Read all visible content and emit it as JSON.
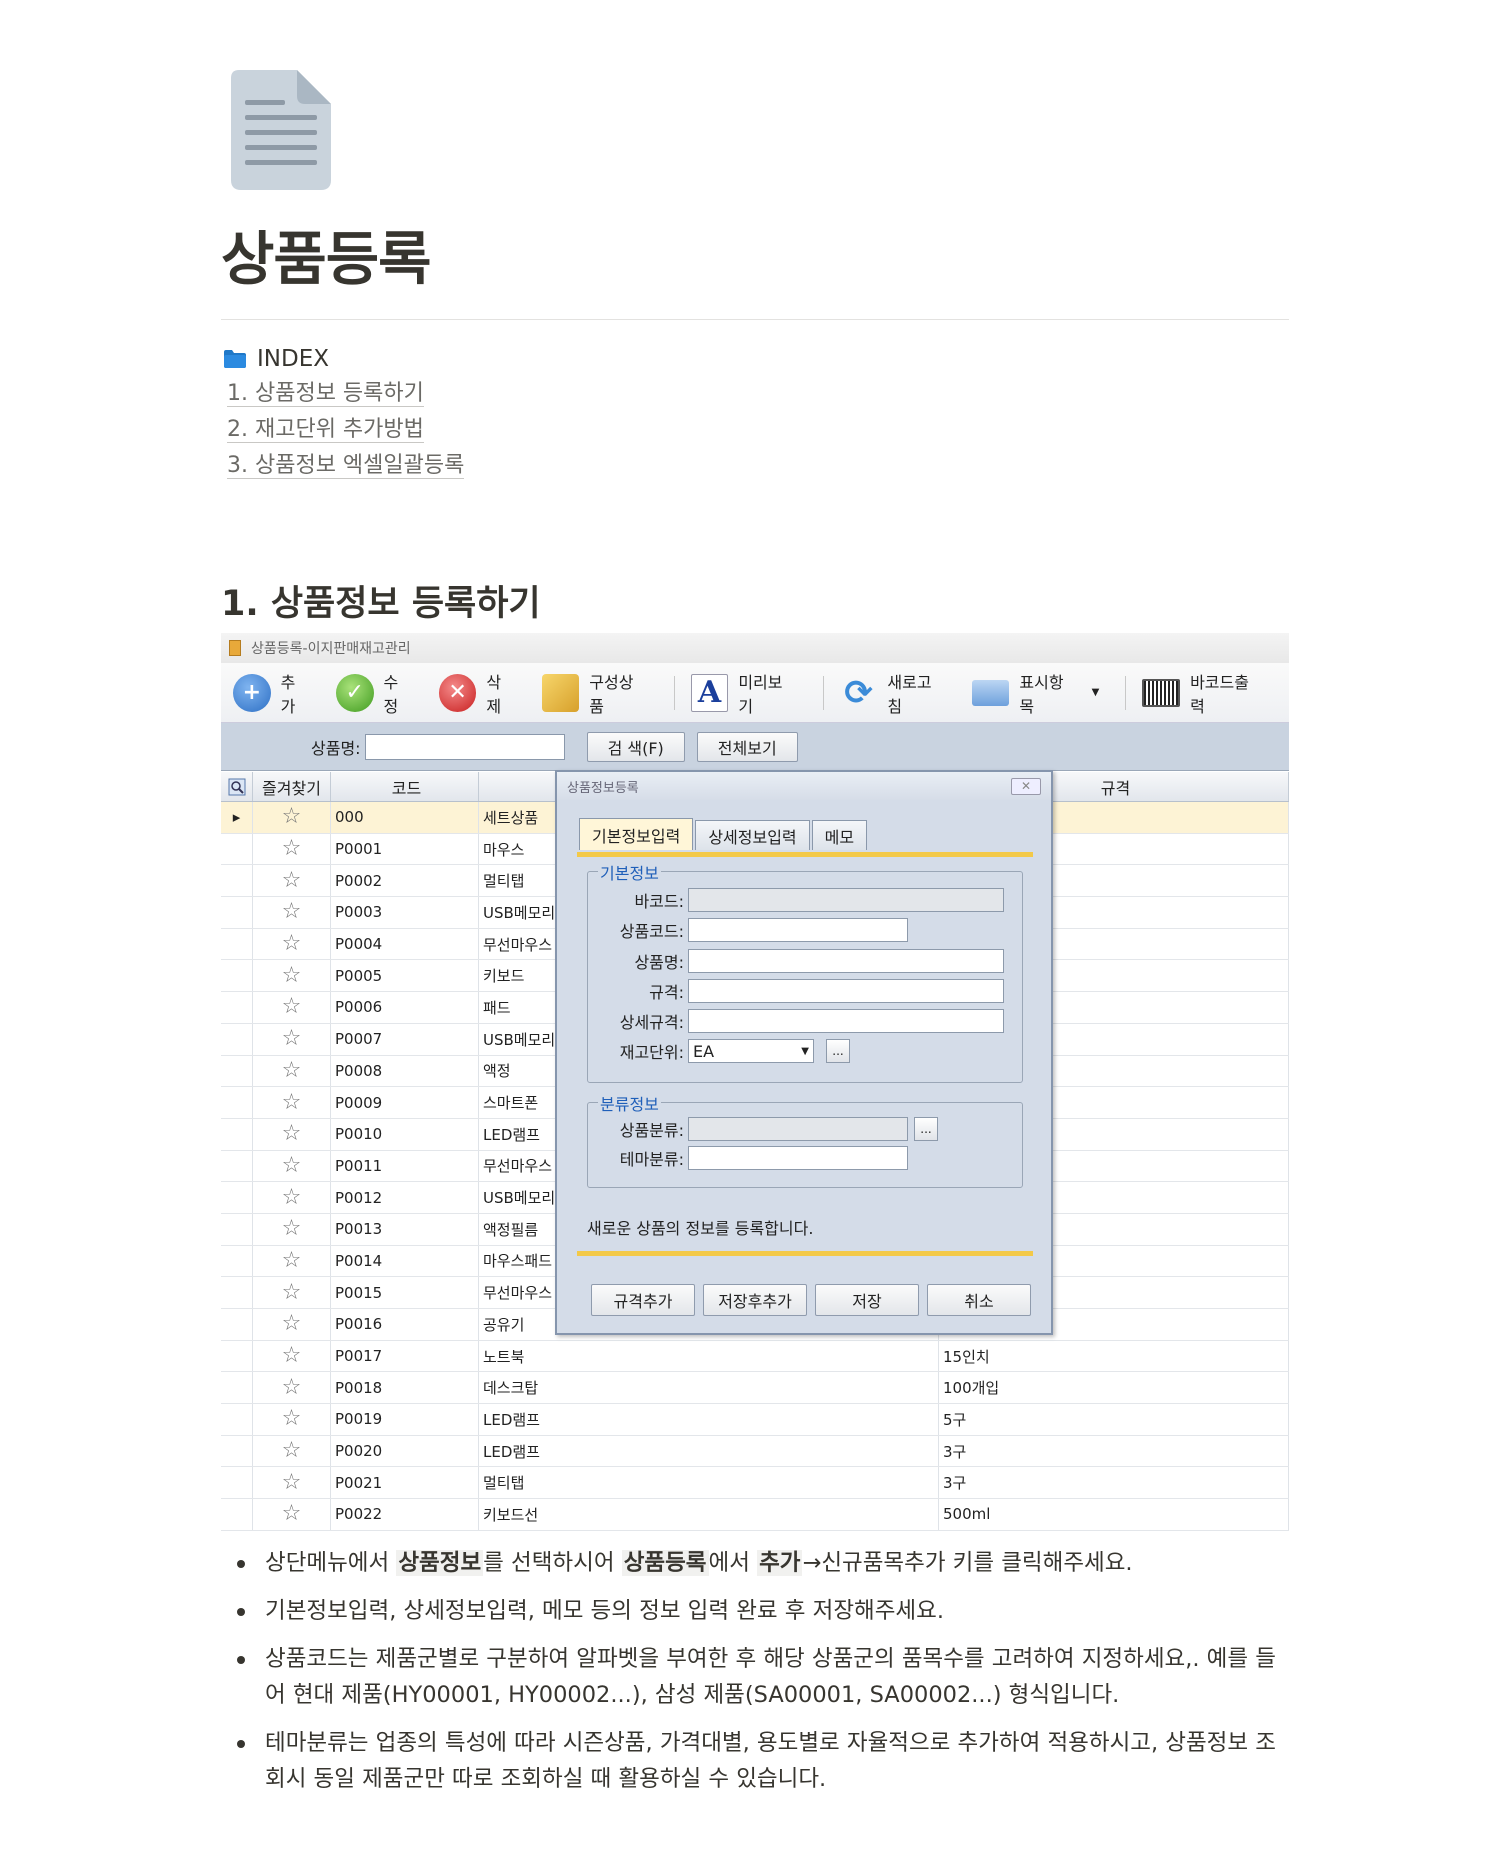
{
  "page": {
    "title": "상품등록",
    "index": {
      "heading": "INDEX",
      "items": [
        "1. 상품정보 등록하기",
        "2. 재고단위 추가방법",
        "3. 상품정보 엑셀일괄등록"
      ]
    },
    "section1": {
      "heading": "1. 상품정보 등록하기"
    }
  },
  "screenshot": {
    "window_title": "상품등록-이지판매재고관리",
    "toolbar": [
      {
        "label": "추가",
        "icon": "add-icon"
      },
      {
        "label": "수정",
        "icon": "check-icon"
      },
      {
        "label": "삭제",
        "icon": "delete-icon"
      },
      {
        "label": "구성상품",
        "icon": "boxes-icon"
      },
      {
        "label": "미리보기",
        "icon": "preview-icon"
      },
      {
        "label": "새로고침",
        "icon": "refresh-icon"
      },
      {
        "label": "표시항목",
        "icon": "columns-icon"
      },
      {
        "label": "바코드출력",
        "icon": "barcode-icon"
      }
    ],
    "search": {
      "label": "상품명:",
      "search_button": "검 색(F)",
      "all_button": "전체보기"
    },
    "grid": {
      "headers": [
        "즐겨찾기",
        "코드",
        "",
        "규격"
      ],
      "rows": [
        {
          "code": "000",
          "name": "세트상품",
          "spec": ""
        },
        {
          "code": "P0001",
          "name": "마우스",
          "spec": ""
        },
        {
          "code": "P0002",
          "name": "멀티탭",
          "spec": ""
        },
        {
          "code": "P0003",
          "name": "USB메모리",
          "spec": ""
        },
        {
          "code": "P0004",
          "name": "무선마우스",
          "spec": ""
        },
        {
          "code": "P0005",
          "name": "키보드",
          "spec": ""
        },
        {
          "code": "P0006",
          "name": "패드",
          "spec": ""
        },
        {
          "code": "P0007",
          "name": "USB메모리",
          "spec": ""
        },
        {
          "code": "P0008",
          "name": "액정",
          "spec": ""
        },
        {
          "code": "P0009",
          "name": "스마트폰",
          "spec": ""
        },
        {
          "code": "P0010",
          "name": "LED램프",
          "spec": ""
        },
        {
          "code": "P0011",
          "name": "무선마우스",
          "spec": ""
        },
        {
          "code": "P0012",
          "name": "USB메모리",
          "spec": ""
        },
        {
          "code": "P0013",
          "name": "액정필름",
          "spec": ""
        },
        {
          "code": "P0014",
          "name": "마우스패드",
          "spec": ""
        },
        {
          "code": "P0015",
          "name": "무선마우스",
          "spec": ""
        },
        {
          "code": "P0016",
          "name": "공유기",
          "spec": ""
        },
        {
          "code": "P0017",
          "name": "노트북",
          "spec": "15인치"
        },
        {
          "code": "P0018",
          "name": "데스크탑",
          "spec": "100개입"
        },
        {
          "code": "P0019",
          "name": "LED램프",
          "spec": "5구"
        },
        {
          "code": "P0020",
          "name": "LED램프",
          "spec": "3구"
        },
        {
          "code": "P0021",
          "name": "멀티탭",
          "spec": "3구"
        },
        {
          "code": "P0022",
          "name": "키보드선",
          "spec": "500ml"
        }
      ]
    },
    "dialog": {
      "title": "상품정보등록",
      "tabs": [
        "기본정보입력",
        "상세정보입력",
        "메모"
      ],
      "basic_group": "기본정보",
      "fields": {
        "barcode": "바코드:",
        "code": "상품코드:",
        "name": "상품명:",
        "spec": "규격:",
        "detail_spec": "상세규격:",
        "unit": "재고단위:",
        "unit_value": "EA"
      },
      "class_group": "분류정보",
      "class_fields": {
        "category": "상품분류:",
        "theme": "테마분류:"
      },
      "ellipsis": "...",
      "note": "새로운 상품의 정보를 등록합니다.",
      "buttons": [
        "규격추가",
        "저장후추가",
        "저장",
        "취소"
      ]
    }
  },
  "bullets": {
    "b1": {
      "p1": "상단메뉴에서 ",
      "k1": "상품정보",
      "p2": "를 선택하시어 ",
      "k2": "상품등록",
      "p3": "에서 ",
      "k3": "추가",
      "p4": "→신규품목추가 키를 클릭해주세요."
    },
    "b2": "기본정보입력, 상세정보입력, 메모 등의 정보 입력 완료 후 저장해주세요.",
    "b3": "상품코드는 제품군별로 구분하여 알파벳을 부여한 후 해당 상품군의 품목수를 고려하여 지정하세요,. 예를 들어 현대 제품(HY00001, HY00002...), 삼성 제품(SA00001, SA00002...) 형식입니다.",
    "b4": "테마분류는 업종의 특성에 따라 시즌상품, 가격대별, 용도별로 자율적으로 추가하여 적용하시고, 상품정보 조회시 동일 제품군만 따로 조회하실 때 활용하실 수 있습니다."
  }
}
